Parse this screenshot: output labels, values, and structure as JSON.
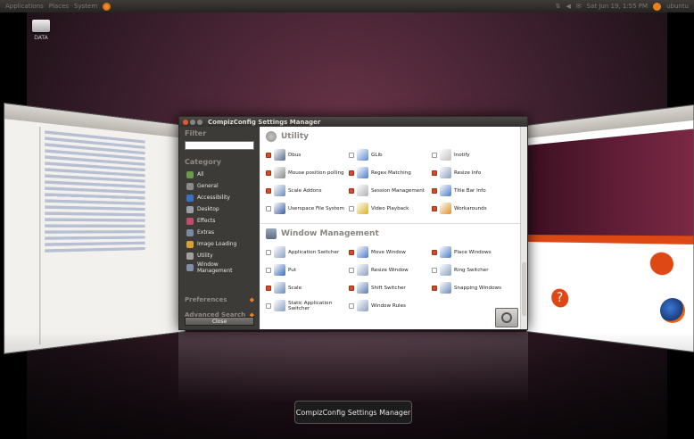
{
  "panel": {
    "menus": [
      "Applications",
      "Places",
      "System"
    ],
    "clock": "Sat Jun 19,  1:55 PM",
    "user": "ubuntu"
  },
  "desktop": {
    "drive_label": "DATA"
  },
  "window": {
    "title": "CompizConfig Settings Manager",
    "sidebar": {
      "filter_label": "Filter",
      "filter_value": "",
      "category_label": "Category",
      "categories": [
        {
          "label": "All",
          "icon": "globe-icon",
          "color": "#6a9a4a"
        },
        {
          "label": "General",
          "icon": "gear-icon",
          "color": "#8b8b8b"
        },
        {
          "label": "Accessibility",
          "icon": "accessibility-icon",
          "color": "#3d6fc1"
        },
        {
          "label": "Desktop",
          "icon": "desktop-icon",
          "color": "#9aa0a8"
        },
        {
          "label": "Effects",
          "icon": "effects-icon",
          "color": "#c24a6a"
        },
        {
          "label": "Extras",
          "icon": "extras-icon",
          "color": "#7a8aa0"
        },
        {
          "label": "Image Loading",
          "icon": "image-icon",
          "color": "#d8a030"
        },
        {
          "label": "Utility",
          "icon": "utility-icon",
          "color": "#a0a0a0"
        },
        {
          "label": "Window Management",
          "icon": "window-icon",
          "color": "#8090a8"
        }
      ],
      "preferences_label": "Preferences",
      "advanced_search_label": "Advanced Search",
      "close_label": "Close"
    },
    "sections": [
      {
        "title": "Utility",
        "plugins": [
          {
            "label": "Dbus",
            "checked": true,
            "color": "#5a6a88"
          },
          {
            "label": "GLib",
            "checked": false,
            "color": "#5a8ad0"
          },
          {
            "label": "Inotify",
            "checked": false,
            "color": "#c0c0c0"
          },
          {
            "label": "Mouse position polling",
            "checked": true,
            "color": "#888888"
          },
          {
            "label": "Regex Matching",
            "checked": true,
            "color": "#4a7ac8"
          },
          {
            "label": "Resize Info",
            "checked": true,
            "color": "#8aa0c0"
          },
          {
            "label": "Scale Addons",
            "checked": true,
            "color": "#6a8ab8"
          },
          {
            "label": "Session Management",
            "checked": true,
            "color": "#b0b0b8"
          },
          {
            "label": "Title Bar Info",
            "checked": true,
            "color": "#4a7ac8"
          },
          {
            "label": "Userspace File System",
            "checked": false,
            "color": "#3a5aa0"
          },
          {
            "label": "Video Playback",
            "checked": false,
            "color": "#d8b020"
          },
          {
            "label": "Workarounds",
            "checked": true,
            "color": "#e0902a"
          }
        ]
      },
      {
        "title": "Window Management",
        "plugins": [
          {
            "label": "Application Switcher",
            "checked": false,
            "color": "#8aa0c0"
          },
          {
            "label": "Move Window",
            "checked": true,
            "color": "#4a7ac8"
          },
          {
            "label": "Place Windows",
            "checked": true,
            "color": "#4a7ac8"
          },
          {
            "label": "Put",
            "checked": false,
            "color": "#3a6ab8"
          },
          {
            "label": "Resize Window",
            "checked": false,
            "color": "#8aa0c0"
          },
          {
            "label": "Ring Switcher",
            "checked": false,
            "color": "#8aa0c0"
          },
          {
            "label": "Scale",
            "checked": true,
            "color": "#6a8ab8"
          },
          {
            "label": "Shift Switcher",
            "checked": true,
            "color": "#5a7ab0"
          },
          {
            "label": "Snapping Windows",
            "checked": true,
            "color": "#6a8ab8"
          },
          {
            "label": "Static Application Switcher",
            "checked": false,
            "color": "#8aa0c0"
          },
          {
            "label": "Window Rules",
            "checked": false,
            "color": "#8aa0c0"
          }
        ]
      }
    ]
  },
  "tooltip": "CompizConfig Settings Manager"
}
